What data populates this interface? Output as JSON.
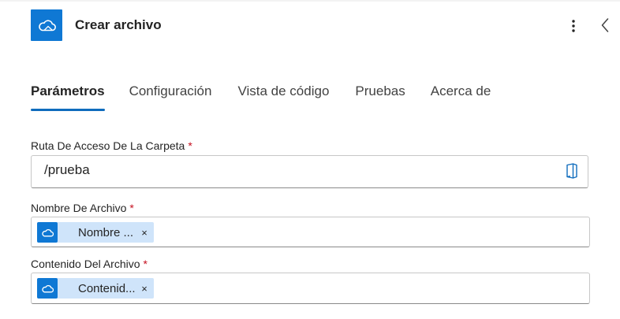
{
  "header": {
    "title": "Crear archivo",
    "app_icon": "onedrive-cloud-icon",
    "more_icon": "more-vertical-icon",
    "collapse_icon": "chevron-left-icon"
  },
  "tabs": [
    {
      "label": "Parámetros",
      "active": true
    },
    {
      "label": "Configuración",
      "active": false
    },
    {
      "label": "Vista de código",
      "active": false
    },
    {
      "label": "Pruebas",
      "active": false
    },
    {
      "label": "Acerca de",
      "active": false
    }
  ],
  "fields": {
    "folder_path": {
      "label": "Ruta De Acceso De La Carpeta",
      "required_mark": "*",
      "value": "/prueba",
      "browse_icon": "folder-browse-icon"
    },
    "file_name": {
      "label": "Nombre De Archivo",
      "required_mark": "*",
      "token": {
        "label": "Nombre ...",
        "remove": "×",
        "icon": "onedrive-cloud-icon"
      }
    },
    "file_content": {
      "label": "Contenido Del Archivo",
      "required_mark": "*",
      "token": {
        "label": "Contenid...",
        "remove": "×",
        "icon": "onedrive-cloud-icon"
      }
    }
  },
  "colors": {
    "accent": "#0f6cbd",
    "app_icon_bg": "#0f78d4",
    "token_bg": "#cfe4fa",
    "required": "#c50f1f"
  }
}
